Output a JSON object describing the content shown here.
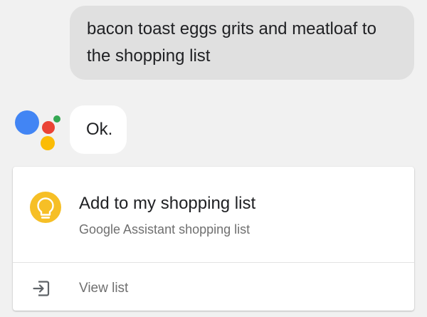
{
  "conversation": {
    "user_message": "bacon toast eggs grits and meatloaf to the shopping list",
    "assistant_reply": "Ok."
  },
  "assistant": {
    "logo_icon": "google-assistant-icon",
    "dot_colors": [
      "#4285f4",
      "#ea4335",
      "#fbbc05",
      "#34a853"
    ]
  },
  "card": {
    "icon": "lightbulb-icon",
    "icon_color": "#f6bf26",
    "title": "Add to my shopping list",
    "subtitle": "Google Assistant shopping list",
    "action": {
      "icon": "open-in-icon",
      "label": "View list"
    }
  }
}
